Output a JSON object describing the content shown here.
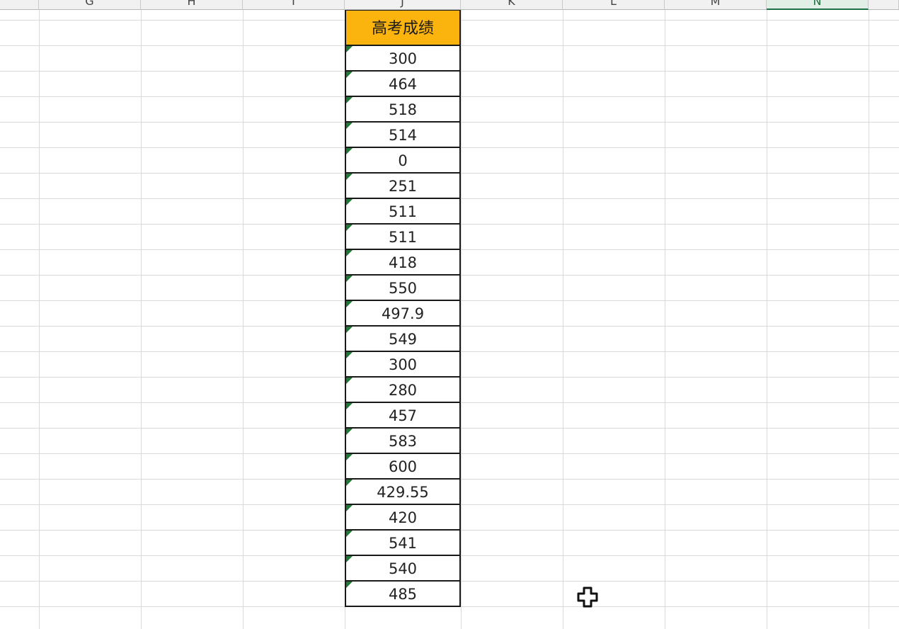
{
  "columns": [
    {
      "label": "G"
    },
    {
      "label": "H"
    },
    {
      "label": "I"
    },
    {
      "label": "J"
    },
    {
      "label": "K"
    },
    {
      "label": "L"
    },
    {
      "label": "M"
    },
    {
      "label": "N",
      "selected": true
    }
  ],
  "table": {
    "header": "高考成绩",
    "header_color": "#fbb30e",
    "values": [
      "300",
      "464",
      "518",
      "514",
      "0",
      "251",
      "511",
      "511",
      "418",
      "550",
      "497.9",
      "549",
      "300",
      "280",
      "457",
      "583",
      "600",
      "429.55",
      "420",
      "541",
      "540",
      "485"
    ]
  },
  "cursor": {
    "icon": "fill-cross-cursor-icon"
  }
}
